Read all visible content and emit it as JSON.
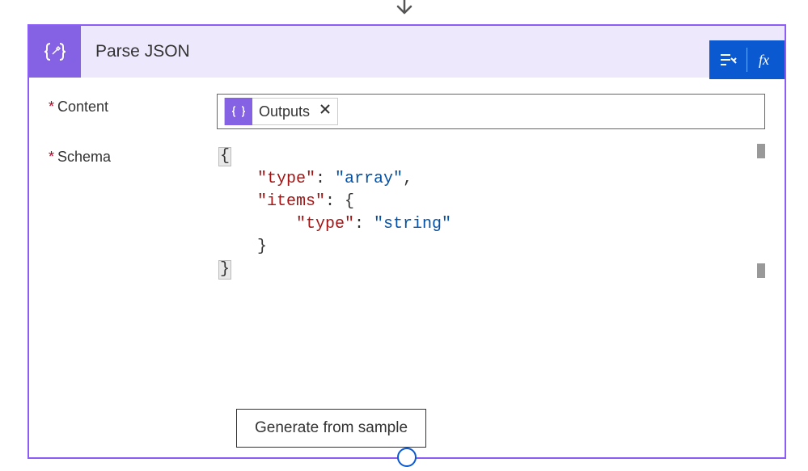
{
  "header": {
    "title": "Parse JSON"
  },
  "fields": {
    "content": {
      "label": "Content",
      "token": "Outputs"
    },
    "schema": {
      "label": "Schema",
      "code": {
        "line2_key": "\"type\"",
        "line2_val": "\"array\"",
        "line3_key": "\"items\"",
        "line4_key": "\"type\"",
        "line4_val": "\"string\""
      }
    }
  },
  "actions": {
    "generate": "Generate from sample"
  }
}
